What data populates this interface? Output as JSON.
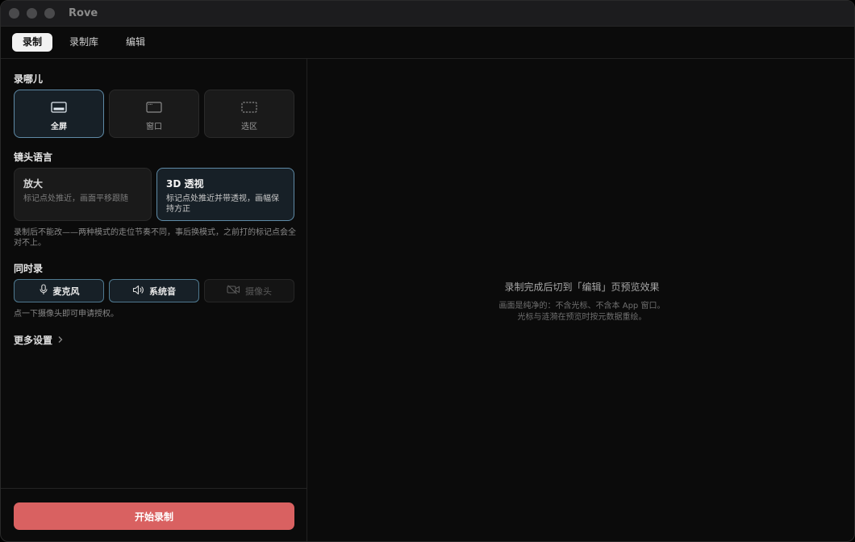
{
  "window": {
    "title": "Rove"
  },
  "tabs": [
    {
      "label": "录制",
      "active": true
    },
    {
      "label": "录制库",
      "active": false
    },
    {
      "label": "编辑",
      "active": false
    }
  ],
  "source": {
    "label": "录哪儿",
    "options": [
      {
        "label": "全屏",
        "icon": "fullscreen-icon",
        "selected": true
      },
      {
        "label": "窗口",
        "icon": "window-icon",
        "selected": false
      },
      {
        "label": "选区",
        "icon": "selection-icon",
        "selected": false
      }
    ]
  },
  "camera_language": {
    "label": "镜头语言",
    "modes": [
      {
        "title": "放大",
        "desc": "标记点处推近，画面平移跟随",
        "selected": false
      },
      {
        "title": "3D 透视",
        "desc": "标记点处推近并带透视，画幅保持方正",
        "selected": true
      }
    ],
    "note": "录制后不能改——两种模式的走位节奏不同，事后换模式，之前打的标记点会全对不上。"
  },
  "simultaneous": {
    "label": "同时录",
    "items": [
      {
        "label": "麦克风",
        "icon": "microphone-icon",
        "enabled": true
      },
      {
        "label": "系统音",
        "icon": "speaker-icon",
        "enabled": true
      },
      {
        "label": "摄像头",
        "icon": "camera-off-icon",
        "enabled": false
      }
    ],
    "note": "点一下摄像头即可申请授权。"
  },
  "more_settings": "更多设置",
  "start_button": "开始录制",
  "preview": {
    "title": "录制完成后切到「编辑」页预览效果",
    "line1": "画面是纯净的：不含光标、不含本 App 窗口。",
    "line2": "光标与涟漪在预览时按元数据重绘。"
  },
  "colors": {
    "accent": "#d96161",
    "selected_border": "#5f8aa6"
  }
}
